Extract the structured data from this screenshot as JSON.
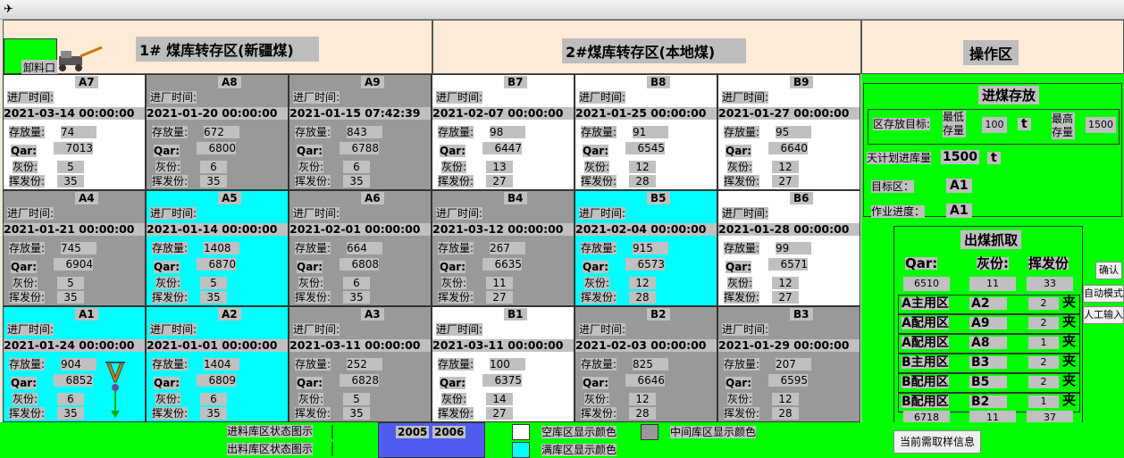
{
  "headers": {
    "zone1": "1# 煤库转存区(新疆煤)",
    "zone2": "2#煤库转存区(本地煤)",
    "ops": "操作区",
    "unload": "卸料口"
  },
  "labels": {
    "in_time": "进厂时间:",
    "stock": "存放量:",
    "qar": "Qar:",
    "ash": "灰份:",
    "vol": "挥发份:"
  },
  "bins": [
    {
      "name": "A7",
      "date": "2021-03-14 00:00:00",
      "stock": "74",
      "qar": "7013",
      "ash": "5",
      "vol": "35",
      "color": "white"
    },
    {
      "name": "A8",
      "date": "2021-01-20 00:00:00",
      "stock": "672",
      "qar": "6800",
      "ash": "6",
      "vol": "35",
      "color": "gray"
    },
    {
      "name": "A9",
      "date": "2021-01-15 07:42:39",
      "stock": "843",
      "qar": "6788",
      "ash": "6",
      "vol": "35",
      "color": "gray"
    },
    {
      "name": "B7",
      "date": "2021-02-07 00:00:00",
      "stock": "98",
      "qar": "6447",
      "ash": "13",
      "vol": "27",
      "color": "white"
    },
    {
      "name": "B8",
      "date": "2021-01-25 00:00:00",
      "stock": "91",
      "qar": "6545",
      "ash": "12",
      "vol": "28",
      "color": "white"
    },
    {
      "name": "B9",
      "date": "2021-01-27 00:00:00",
      "stock": "95",
      "qar": "6640",
      "ash": "12",
      "vol": "27",
      "color": "white"
    },
    {
      "name": "A4",
      "date": "2021-01-21 00:00:00",
      "stock": "745",
      "qar": "6904",
      "ash": "5",
      "vol": "35",
      "color": "gray"
    },
    {
      "name": "A5",
      "date": "2021-01-14 00:00:00",
      "stock": "1408",
      "qar": "6870",
      "ash": "5",
      "vol": "35",
      "color": "cyan"
    },
    {
      "name": "A6",
      "date": "2021-02-01 00:00:00",
      "stock": "664",
      "qar": "6808",
      "ash": "6",
      "vol": "35",
      "color": "gray"
    },
    {
      "name": "B4",
      "date": "2021-03-12 00:00:00",
      "stock": "267",
      "qar": "6635",
      "ash": "11",
      "vol": "27",
      "color": "gray"
    },
    {
      "name": "B5",
      "date": "2021-02-04 00:00:00",
      "stock": "915",
      "qar": "6573",
      "ash": "12",
      "vol": "28",
      "color": "cyan"
    },
    {
      "name": "B6",
      "date": "2021-01-28 00:00:00",
      "stock": "99",
      "qar": "6571",
      "ash": "12",
      "vol": "27",
      "color": "white"
    },
    {
      "name": "A1",
      "date": "2021-01-24 00:00:00",
      "stock": "904",
      "qar": "6852",
      "ash": "6",
      "vol": "35",
      "color": "cyan"
    },
    {
      "name": "A2",
      "date": "2021-01-01 00:00:00",
      "stock": "1404",
      "qar": "6809",
      "ash": "6",
      "vol": "35",
      "color": "cyan"
    },
    {
      "name": "A3",
      "date": "2021-03-11 00:00:00",
      "stock": "252",
      "qar": "6828",
      "ash": "5",
      "vol": "35",
      "color": "gray"
    },
    {
      "name": "B1",
      "date": "2021-03-11 00:00:00",
      "stock": "100",
      "qar": "6375",
      "ash": "14",
      "vol": "27",
      "color": "white"
    },
    {
      "name": "B2",
      "date": "2021-02-03 00:00:00",
      "stock": "825",
      "qar": "6646",
      "ash": "12",
      "vol": "28",
      "color": "gray"
    },
    {
      "name": "B3",
      "date": "2021-01-29 00:00:00",
      "stock": "207",
      "qar": "6595",
      "ash": "12",
      "vol": "28",
      "color": "gray"
    }
  ],
  "intake": {
    "title": "进煤存放",
    "target_label": "区存放目标:",
    "min_label": "最低存量",
    "min_value": "100",
    "unit": "t",
    "max_label": "最高存量",
    "max_value": "1500",
    "plan_label": "天计划进库量",
    "plan_value": "1500",
    "zone_label": "目标区：",
    "zone_value": "A1",
    "progress_label": "作业进度：",
    "progress_value": "A1"
  },
  "outtake": {
    "title": "出煤抓取",
    "col_qar": "Qar:",
    "col_ash": "灰份:",
    "col_vol": "挥发份",
    "sum_qar": "6510",
    "sum_ash": "11",
    "sum_vol": "33",
    "rows": [
      {
        "zone": "A主用区",
        "bin": "A2",
        "count": "2"
      },
      {
        "zone": "A配用区",
        "bin": "A9",
        "count": "2"
      },
      {
        "zone": "A配用区",
        "bin": "A8",
        "count": "1"
      },
      {
        "zone": "B主用区",
        "bin": "B3",
        "count": "2"
      },
      {
        "zone": "B配用区",
        "bin": "B5",
        "count": "2"
      },
      {
        "zone": "B配用区",
        "bin": "B2",
        "count": "1"
      }
    ],
    "unit": "夹",
    "total_qar": "6718",
    "total_ash": "11",
    "total_vol": "37"
  },
  "buttons": {
    "confirm": "确认",
    "auto": "自动模式",
    "manual": "人工输入",
    "sample": "当前需取样信息"
  },
  "legend": {
    "in_state": "进料库区状态图示",
    "out_state": "出料库区状态图示",
    "num_a": "2005",
    "num_b": "2006",
    "empty": "空库区显示颜色",
    "middle": "中间库区显示颜色",
    "full": "满库区显示颜色"
  },
  "colors": {
    "empty": "#ffffff",
    "full": "#00ffff",
    "middle": "#999999",
    "panel": "#00ff00",
    "blue": "#4f5cf0"
  }
}
